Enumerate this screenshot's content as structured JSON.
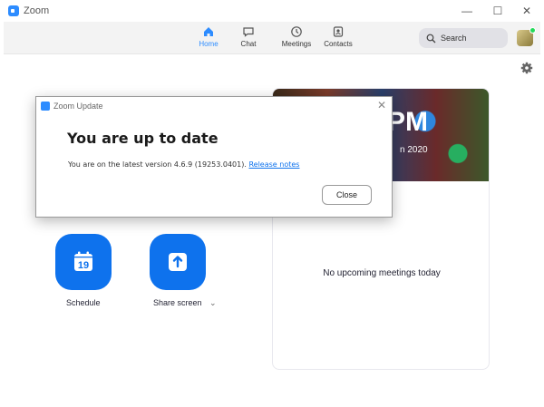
{
  "window": {
    "title": "Zoom",
    "minimize": "—",
    "maximize": "☐",
    "close": "✕"
  },
  "nav": {
    "tabs": [
      {
        "label": "Home",
        "icon": "home-icon",
        "active": true
      },
      {
        "label": "Chat",
        "icon": "chat-icon"
      },
      {
        "label": "Meetings",
        "icon": "clock-icon"
      },
      {
        "label": "Contacts",
        "icon": "contacts-icon"
      }
    ],
    "search_placeholder": "Search",
    "accent": "#2d8cff"
  },
  "banner": {
    "clock": "PM",
    "date": "n 2020"
  },
  "actions": {
    "schedule": {
      "label": "Schedule",
      "day": "19"
    },
    "share": {
      "label": "Share screen",
      "chevron": "⌄"
    }
  },
  "meetings": {
    "empty_text": "No upcoming meetings today"
  },
  "dialog": {
    "title": "Zoom Update",
    "heading": "You are up to date",
    "message": "You are on the latest version 4.6.9 (19253.0401).",
    "link": "Release notes",
    "close_label": "Close",
    "close_x": "✕"
  }
}
